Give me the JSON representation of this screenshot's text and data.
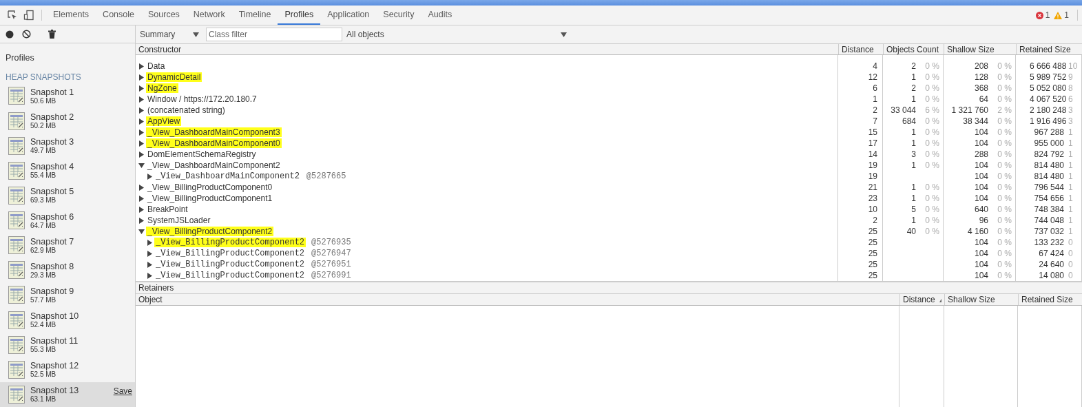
{
  "tabs": [
    {
      "label": "Elements",
      "selected": false
    },
    {
      "label": "Console",
      "selected": false
    },
    {
      "label": "Sources",
      "selected": false
    },
    {
      "label": "Network",
      "selected": false
    },
    {
      "label": "Timeline",
      "selected": false
    },
    {
      "label": "Profiles",
      "selected": true
    },
    {
      "label": "Application",
      "selected": false
    },
    {
      "label": "Security",
      "selected": false
    },
    {
      "label": "Audits",
      "selected": false
    }
  ],
  "status": {
    "errors": "1",
    "warnings": "1"
  },
  "toolbar": {
    "view": "Summary",
    "filter_placeholder": "Class filter",
    "scope": "All objects"
  },
  "sidebar": {
    "title": "Profiles",
    "section": "HEAP SNAPSHOTS",
    "items": [
      {
        "name": "Snapshot 1",
        "size": "50.6 MB",
        "selected": false
      },
      {
        "name": "Snapshot 2",
        "size": "50.2 MB",
        "selected": false
      },
      {
        "name": "Snapshot 3",
        "size": "49.7 MB",
        "selected": false
      },
      {
        "name": "Snapshot 4",
        "size": "55.4 MB",
        "selected": false
      },
      {
        "name": "Snapshot 5",
        "size": "69.3 MB",
        "selected": false
      },
      {
        "name": "Snapshot 6",
        "size": "64.7 MB",
        "selected": false
      },
      {
        "name": "Snapshot 7",
        "size": "62.9 MB",
        "selected": false
      },
      {
        "name": "Snapshot 8",
        "size": "29.3 MB",
        "selected": false
      },
      {
        "name": "Snapshot 9",
        "size": "57.7 MB",
        "selected": false
      },
      {
        "name": "Snapshot 10",
        "size": "52.4 MB",
        "selected": false
      },
      {
        "name": "Snapshot 11",
        "size": "55.3 MB",
        "selected": false
      },
      {
        "name": "Snapshot 12",
        "size": "52.5 MB",
        "selected": false
      },
      {
        "name": "Snapshot 13",
        "size": "63.1 MB",
        "selected": true,
        "action": "Save"
      }
    ]
  },
  "table": {
    "columns": [
      "Constructor",
      "Distance",
      "Objects Count",
      "Shallow Size",
      "Retained Size"
    ],
    "rows": [
      {
        "name": "Data",
        "highlighted": false,
        "expanded": false,
        "distance": "4",
        "count": "2",
        "count_pct": "0 %",
        "shallow": "208",
        "shallow_pct": "0 %",
        "retained": "6 666 488",
        "retained_pct": "10"
      },
      {
        "name": "DynamicDetail",
        "highlighted": true,
        "expanded": false,
        "distance": "12",
        "count": "1",
        "count_pct": "0 %",
        "shallow": "128",
        "shallow_pct": "0 %",
        "retained": "5 989 752",
        "retained_pct": "9"
      },
      {
        "name": "NgZone",
        "highlighted": true,
        "expanded": false,
        "distance": "6",
        "count": "2",
        "count_pct": "0 %",
        "shallow": "368",
        "shallow_pct": "0 %",
        "retained": "5 052 080",
        "retained_pct": "8"
      },
      {
        "name": "Window / https://172.20.180.7",
        "highlighted": false,
        "expanded": false,
        "distance": "1",
        "count": "1",
        "count_pct": "0 %",
        "shallow": "64",
        "shallow_pct": "0 %",
        "retained": "4 067 520",
        "retained_pct": "6"
      },
      {
        "name": "(concatenated string)",
        "highlighted": false,
        "expanded": false,
        "distance": "2",
        "count": "33 044",
        "count_pct": "6 %",
        "shallow": "1 321 760",
        "shallow_pct": "2 %",
        "retained": "2 180 248",
        "retained_pct": "3"
      },
      {
        "name": "AppView",
        "highlighted": true,
        "expanded": false,
        "distance": "7",
        "count": "684",
        "count_pct": "0 %",
        "shallow": "38 344",
        "shallow_pct": "0 %",
        "retained": "1 916 496",
        "retained_pct": "3"
      },
      {
        "name": "_View_DashboardMainComponent3",
        "highlighted": true,
        "expanded": false,
        "distance": "15",
        "count": "1",
        "count_pct": "0 %",
        "shallow": "104",
        "shallow_pct": "0 %",
        "retained": "967 288",
        "retained_pct": "1"
      },
      {
        "name": "_View_DashboardMainComponent0",
        "highlighted": true,
        "expanded": false,
        "distance": "17",
        "count": "1",
        "count_pct": "0 %",
        "shallow": "104",
        "shallow_pct": "0 %",
        "retained": "955 000",
        "retained_pct": "1"
      },
      {
        "name": "DomElementSchemaRegistry",
        "highlighted": false,
        "expanded": false,
        "distance": "14",
        "count": "3",
        "count_pct": "0 %",
        "shallow": "288",
        "shallow_pct": "0 %",
        "retained": "824 792",
        "retained_pct": "1"
      },
      {
        "name": "_View_DashboardMainComponent2",
        "highlighted": false,
        "expanded": true,
        "distance": "19",
        "count": "1",
        "count_pct": "0 %",
        "shallow": "104",
        "shallow_pct": "0 %",
        "retained": "814 480",
        "retained_pct": "1",
        "children": [
          {
            "name": "_View_DashboardMainComponent2",
            "object_id": "@5287665",
            "highlighted": false,
            "expanded": false,
            "distance": "19",
            "shallow": "104",
            "shallow_pct": "0 %",
            "retained": "814 480",
            "retained_pct": "1"
          }
        ]
      },
      {
        "name": "_View_BillingProductComponent0",
        "highlighted": false,
        "expanded": false,
        "distance": "21",
        "count": "1",
        "count_pct": "0 %",
        "shallow": "104",
        "shallow_pct": "0 %",
        "retained": "796 544",
        "retained_pct": "1"
      },
      {
        "name": "_View_BillingProductComponent1",
        "highlighted": false,
        "expanded": false,
        "distance": "23",
        "count": "1",
        "count_pct": "0 %",
        "shallow": "104",
        "shallow_pct": "0 %",
        "retained": "754 656",
        "retained_pct": "1"
      },
      {
        "name": "BreakPoint",
        "highlighted": false,
        "expanded": false,
        "distance": "10",
        "count": "5",
        "count_pct": "0 %",
        "shallow": "640",
        "shallow_pct": "0 %",
        "retained": "748 384",
        "retained_pct": "1"
      },
      {
        "name": "SystemJSLoader",
        "highlighted": false,
        "expanded": false,
        "distance": "2",
        "count": "1",
        "count_pct": "0 %",
        "shallow": "96",
        "shallow_pct": "0 %",
        "retained": "744 048",
        "retained_pct": "1"
      },
      {
        "name": "_View_BillingProductComponent2",
        "highlighted": true,
        "expanded": true,
        "distance": "25",
        "count": "40",
        "count_pct": "0 %",
        "shallow": "4 160",
        "shallow_pct": "0 %",
        "retained": "737 032",
        "retained_pct": "1",
        "children": [
          {
            "name": "_View_BillingProductComponent2",
            "object_id": "@5276935",
            "highlighted": true,
            "expanded": false,
            "distance": "25",
            "shallow": "104",
            "shallow_pct": "0 %",
            "retained": "133 232",
            "retained_pct": "0"
          },
          {
            "name": "_View_BillingProductComponent2",
            "object_id": "@5276947",
            "highlighted": false,
            "expanded": false,
            "distance": "25",
            "shallow": "104",
            "shallow_pct": "0 %",
            "retained": "67 424",
            "retained_pct": "0"
          },
          {
            "name": "_View_BillingProductComponent2",
            "object_id": "@5276951",
            "highlighted": false,
            "expanded": false,
            "distance": "25",
            "shallow": "104",
            "shallow_pct": "0 %",
            "retained": "24 640",
            "retained_pct": "0"
          },
          {
            "name": "_View_BillingProductComponent2",
            "object_id": "@5276991",
            "highlighted": false,
            "expanded": false,
            "distance": "25",
            "shallow": "104",
            "shallow_pct": "0 %",
            "retained": "14 080",
            "retained_pct": "0"
          }
        ]
      }
    ]
  },
  "retainers": {
    "title": "Retainers",
    "columns": [
      {
        "label": "Object",
        "sorted": false
      },
      {
        "label": "Distance",
        "sorted": true
      },
      {
        "label": "Shallow Size",
        "sorted": false
      },
      {
        "label": "Retained Size",
        "sorted": false
      }
    ]
  }
}
